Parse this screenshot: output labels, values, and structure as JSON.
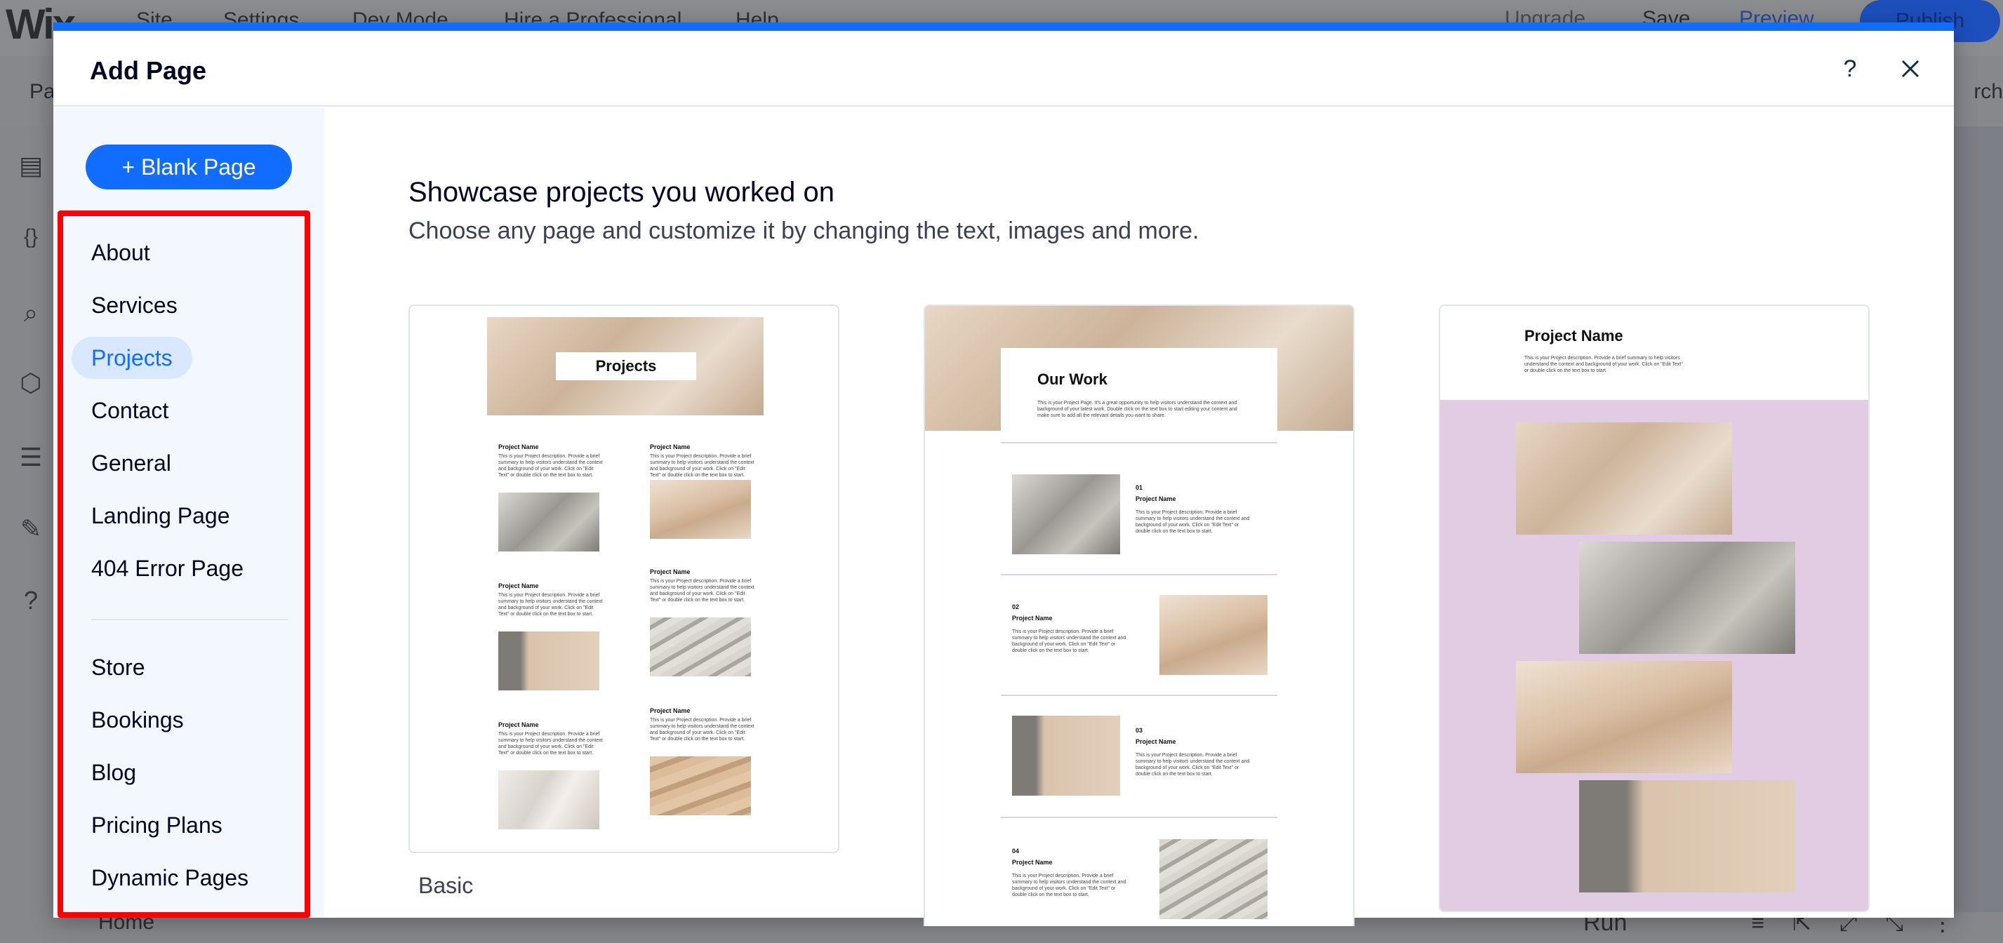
{
  "editor": {
    "logo": "Wix",
    "menu": [
      "Site",
      "Settings",
      "Dev Mode",
      "Hire a Professional",
      "Help"
    ],
    "upgrade": "Upgrade",
    "save": "Save",
    "preview": "Preview",
    "publish": "Publish",
    "pages_label": "Pa",
    "search_label": "rch",
    "bottom_home": "Home",
    "bottom_run": "Run"
  },
  "modal": {
    "title": "Add Page",
    "help_label": "?",
    "blank_page": "+ Blank Page",
    "nav_primary": [
      "About",
      "Services",
      "Projects",
      "Contact",
      "General",
      "Landing Page",
      "404 Error Page"
    ],
    "nav_secondary": [
      "Store",
      "Bookings",
      "Blog",
      "Pricing Plans",
      "Dynamic Pages"
    ],
    "active_item": "Projects",
    "heading": "Showcase projects you worked on",
    "subheading": "Choose any page and customize it by changing the text, images and more."
  },
  "cards": [
    {
      "label": "Basic",
      "banner_title": "Projects",
      "project_title": "Project Name",
      "project_text": "This is your Project description. Provide a brief summary to help visitors understand the context and background of your work. Click on \"Edit Text\" or double click on the text box to start."
    },
    {
      "label": "",
      "banner_title": "Our Work",
      "banner_text": "This is your Project Page. It's a great opportunity to help visitors understand the context and background of your latest work. Double click on the text box to start editing your content and make sure to add all the relevant details you want to share.",
      "project_title": "Project Name",
      "numbers": [
        "01",
        "02",
        "03",
        "04"
      ],
      "project_text": "This is your Project description. Provide a brief summary to help visitors understand the context and background of your work. Click on \"Edit Text\" or double click on the text box to start."
    },
    {
      "label": "",
      "banner_title": "Project Name",
      "banner_text": "This is your Project description. Provide a brief summary to help visitors understand the context and background of your work. Click on \"Edit Text\" or double click on the text box to start.",
      "accent_color": "#e1cce4"
    }
  ],
  "colors": {
    "accent": "#116dff",
    "active_bg": "#d9e8ff",
    "highlight_border": "#ff0000",
    "sidebar_bg": "#f2f8fe"
  }
}
